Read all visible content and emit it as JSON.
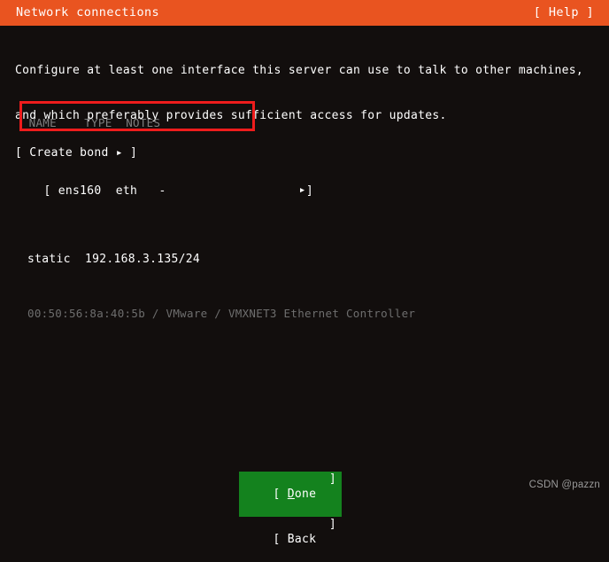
{
  "header": {
    "title": "Network connections",
    "help_label": "[ Help ]",
    "bg_color": "#e95420",
    "fg_color": "#ffffff"
  },
  "intro": {
    "line1": "Configure at least one interface this server can use to talk to other machines,",
    "line2": "and which preferably provides sufficient access for updates."
  },
  "table": {
    "columns": {
      "name": "NAME",
      "type": "TYPE",
      "notes": "NOTES"
    },
    "header_line": "  NAME    TYPE  NOTES",
    "interfaces": [
      {
        "bracket_open": "[ ",
        "name": "ens160",
        "type": "eth",
        "notes": "-",
        "row_text": "[ ens160  eth   -",
        "arrow": "▸",
        "bracket_close": "]",
        "config_mode": "static",
        "address": "192.168.3.135/24",
        "detail_line": "static  192.168.3.135/24",
        "mac": "00:50:56:8a:40:5b",
        "vendor": "VMware",
        "model": "VMXNET3 Ethernet Controller",
        "hw_line": "00:50:56:8a:40:5b / VMware / VMXNET3 Ethernet Controller"
      }
    ]
  },
  "annotation": {
    "color": "#ee1c1c",
    "target": "static-ip-configuration"
  },
  "actions": {
    "create_bond": "[ Create bond ▸ ]"
  },
  "footer": {
    "buttons": [
      {
        "bracket_open": "[ ",
        "accel": "D",
        "rest": "one",
        "bracket_close": "]",
        "selected": true,
        "bg_color": "#14821e"
      },
      {
        "bracket_open": "[ ",
        "accel": "",
        "rest": "Back",
        "bracket_close": "]",
        "selected": false,
        "bg_color": "transparent"
      }
    ]
  },
  "watermark": {
    "text": "CSDN @pazzn"
  }
}
